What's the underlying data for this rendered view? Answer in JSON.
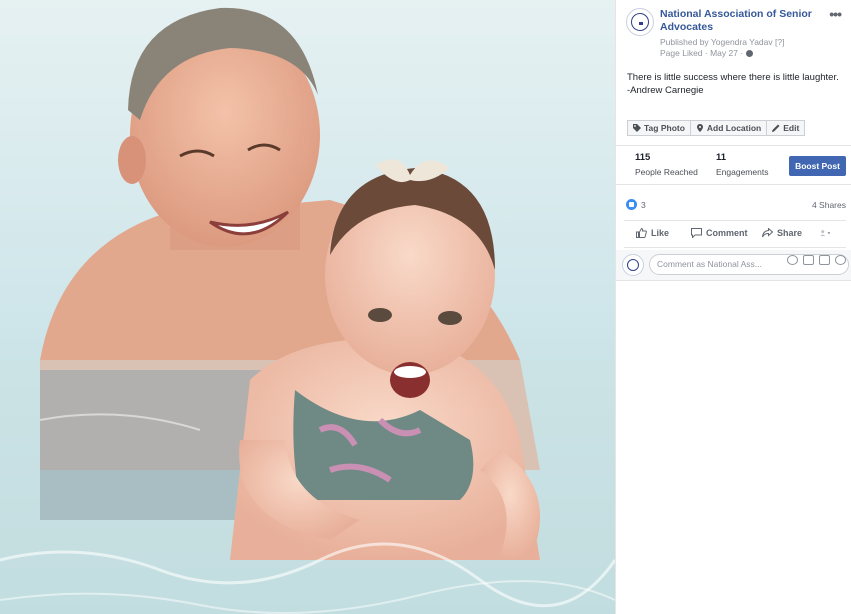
{
  "post": {
    "page_name": "National Association of Senior Advocates",
    "published_by": "Published by Yogendra Yadav [?]",
    "page_liked": "Page Liked · May 27 ·",
    "text_line1": "There is little success where there is little laughter.",
    "text_line2": "-Andrew Carnegie",
    "more": "•••"
  },
  "photo_actions": {
    "tag_photo": "Tag Photo",
    "add_location": "Add Location",
    "edit": "Edit"
  },
  "insights": {
    "reach_value": "115",
    "reach_label": "People Reached",
    "engagement_value": "11",
    "engagement_label": "Engagements",
    "boost_label": "Boost Post"
  },
  "reactions": {
    "count": "3",
    "shares": "4 Shares"
  },
  "action_bar": {
    "like": "Like",
    "comment": "Comment",
    "share": "Share"
  },
  "comment_box": {
    "placeholder": "Comment as National Ass..."
  },
  "colors": {
    "link_blue": "#365899",
    "boost_blue": "#4267b2",
    "like_blue": "#3b8df2",
    "pool_water": "#cfe6ea"
  }
}
